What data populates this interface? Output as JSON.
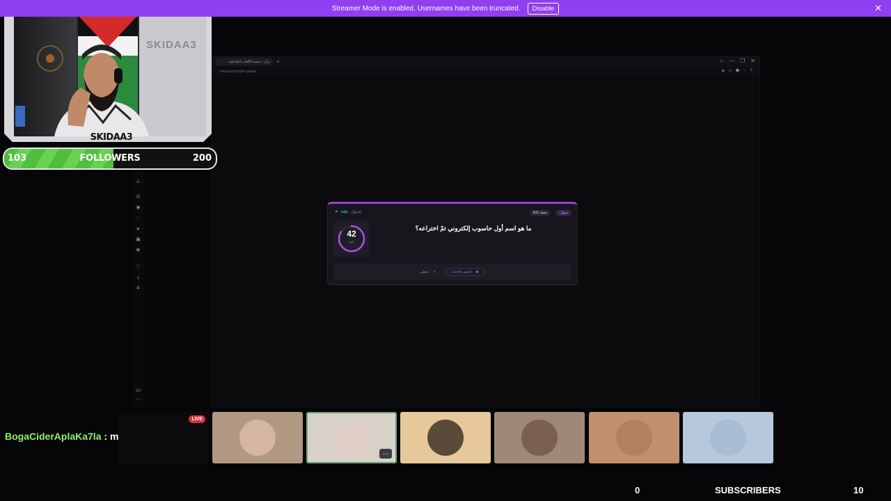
{
  "banner": {
    "message": "Streamer Mode is enabled. Usernames have been truncated.",
    "disable_label": "Disable",
    "close_glyph": "✕",
    "color": "#8f3ff0"
  },
  "browser": {
    "tab_title": "نزال - منصة الألعاب التفاعلية",
    "new_tab_glyph": "+",
    "url": "nezzal.com/sin-game",
    "window_controls": [
      "⌕",
      "—",
      "❐",
      "✕"
    ],
    "toolbar_icons": [
      "shield-icon",
      "bookmark-icon",
      "extension-icon",
      "heart-icon",
      "menu-icon"
    ]
  },
  "sidebar": {
    "icons": [
      "ghost-icon",
      "settings-icon",
      "chat-icon",
      "whatsapp-icon",
      "telegram-icon",
      "instagram-icon",
      "discord-icon",
      "heart-icon",
      "download-icon",
      "gear-icon"
    ],
    "footer_text": "GX"
  },
  "quiz": {
    "username": "najla",
    "user_prefix": "السؤال",
    "points": "600 نقطة",
    "type_badge": "سؤال",
    "timer_value": "42",
    "timer_unit": "ثانية",
    "timer_fraction": 0.84,
    "question": "ما هو اسم أول حاسوب إلكتروني تمّ اختراعه؟",
    "skip_label": "تخطي",
    "reveal_label": "اكشف الإجابة",
    "accent": "#9b3fd6"
  },
  "webcam": {
    "name_tag": "SKIDAA3",
    "wall_text": "SKIDAA3"
  },
  "followers": {
    "current": "103",
    "label": "FOLLOWERS",
    "goal": "200",
    "progress": 0.515
  },
  "chat": {
    "username": "BogaCiderAplaKa7la",
    "separator": " : ",
    "message": "masera💬"
  },
  "participants": [
    {
      "bg": "#b89a86",
      "avatar": "#c49a80",
      "live": "LIVE"
    },
    {
      "bg": "#b09882",
      "avatar": "#d4b6a2"
    },
    {
      "bg": "#d8d2c8",
      "avatar": "#e0d0c8",
      "selected": true,
      "more": "…"
    },
    {
      "bg": "#e6c89a",
      "avatar": "#5a4a3a"
    },
    {
      "bg": "#a08878",
      "avatar": "#7a6050"
    },
    {
      "bg": "#c09070",
      "avatar": "#b08060"
    },
    {
      "bg": "#b8c8dc",
      "avatar": "#a8bcd4"
    }
  ],
  "subscribers": {
    "current": "0",
    "label": "SUBSCRIBERS",
    "goal": "10"
  }
}
